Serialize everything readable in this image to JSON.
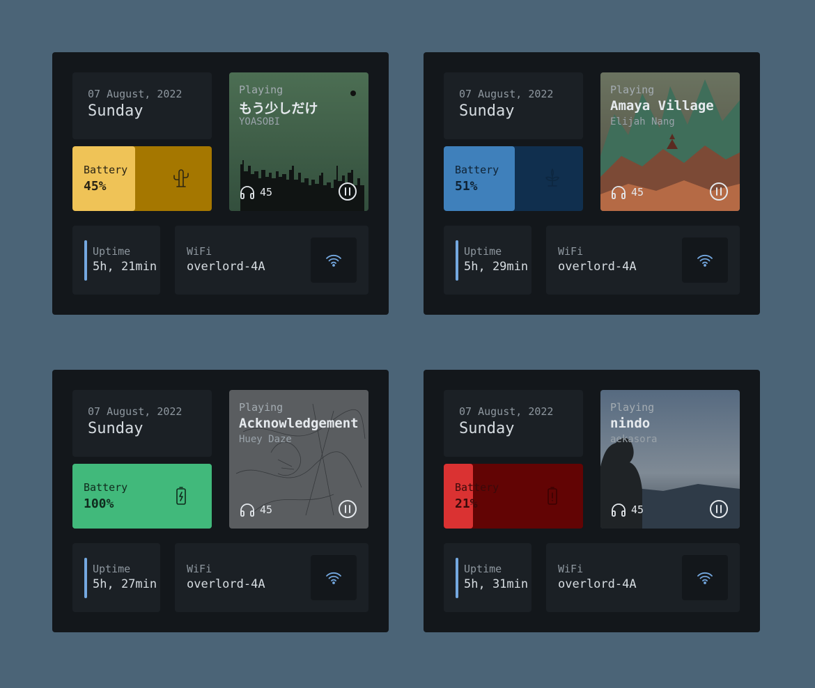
{
  "widgets": [
    {
      "date": "07 August, 2022",
      "day": "Sunday",
      "battery": {
        "label": "Battery",
        "value": "45%",
        "level": 0.45,
        "icon": "cactus-icon",
        "fill_color": "#efc357",
        "bg_color": "#a57700",
        "text_color": "#2a2414",
        "icon_color": "#2d2612"
      },
      "music": {
        "label": "Playing",
        "title": "もう少しだけ",
        "artist": "YOASOBI",
        "volume": "45",
        "art": "green-city-skyline"
      },
      "uptime": {
        "label": "Uptime",
        "value": "5h, 21min"
      },
      "wifi": {
        "label": "WiFi",
        "value": "overlord-4A"
      }
    },
    {
      "date": "07 August, 2022",
      "day": "Sunday",
      "battery": {
        "label": "Battery",
        "value": "51%",
        "level": 0.51,
        "icon": "leaf-icon",
        "fill_color": "#3f80bb",
        "bg_color": "#102f4e",
        "text_color": "#0f2234",
        "icon_color": "#0d2740"
      },
      "music": {
        "label": "Playing",
        "title": "Amaya Village",
        "artist": "Elijah Nang",
        "volume": "45",
        "art": "mountain-village"
      },
      "uptime": {
        "label": "Uptime",
        "value": "5h, 29min"
      },
      "wifi": {
        "label": "WiFi",
        "value": "overlord-4A"
      }
    },
    {
      "date": "07 August, 2022",
      "day": "Sunday",
      "battery": {
        "label": "Battery",
        "value": "100%",
        "level": 1.0,
        "icon": "battery-charging-icon",
        "fill_color": "#41b97b",
        "bg_color": "#41b97b",
        "text_color": "#102a1d",
        "icon_color": "#0f2a1c"
      },
      "music": {
        "label": "Playing",
        "title": "Acknowledgement",
        "artist": "Huey Daze",
        "volume": "45",
        "art": "grey-sketch"
      },
      "uptime": {
        "label": "Uptime",
        "value": "5h, 27min"
      },
      "wifi": {
        "label": "WiFi",
        "value": "overlord-4A"
      }
    },
    {
      "date": "07 August, 2022",
      "day": "Sunday",
      "battery": {
        "label": "Battery",
        "value": "21%",
        "level": 0.21,
        "icon": "battery-low-icon",
        "fill_color": "#da3232",
        "bg_color": "#620404",
        "text_color": "#3a0a0a",
        "icon_color": "#3a0202"
      },
      "music": {
        "label": "Playing",
        "title": "nindo",
        "artist": "aekasora",
        "volume": "45",
        "art": "cliff-silhouette"
      },
      "uptime": {
        "label": "Uptime",
        "value": "5h, 31min"
      },
      "wifi": {
        "label": "WiFi",
        "value": "overlord-4A"
      }
    }
  ]
}
